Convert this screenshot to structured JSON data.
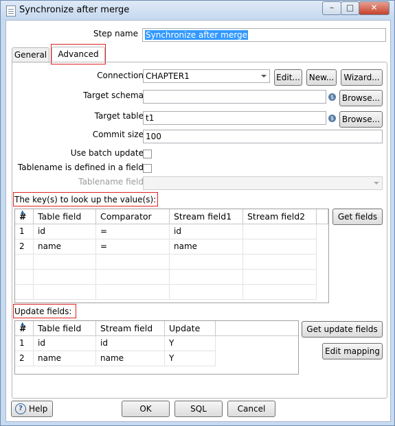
{
  "window": {
    "title": "Synchronize after merge",
    "minimize": "–",
    "maximize": "□",
    "close": "✕"
  },
  "step": {
    "label": "Step name",
    "value": "Synchronize after merge"
  },
  "tabs": [
    {
      "label": "General"
    },
    {
      "label": "Advanced"
    }
  ],
  "form": {
    "connection": {
      "label": "Connection",
      "value": "CHAPTER1",
      "edit": "Edit...",
      "new": "New...",
      "wizard": "Wizard..."
    },
    "target_schema": {
      "label": "Target schema",
      "value": "",
      "browse": "Browse..."
    },
    "target_table": {
      "label": "Target table",
      "value": "t1",
      "browse": "Browse..."
    },
    "commit_size": {
      "label": "Commit size",
      "value": "100"
    },
    "use_batch": {
      "label": "Use batch update",
      "checked": false
    },
    "tablename_in_field": {
      "label": "Tablename is defined in a field",
      "checked": false
    },
    "tablename_field": {
      "label": "Tablename field",
      "value": ""
    },
    "variable_icon": "$"
  },
  "keys": {
    "title": "The key(s) to look up the value(s):",
    "headers": [
      "#",
      "Table field",
      "Comparator",
      "Stream field1",
      "Stream field2"
    ],
    "rows": [
      [
        "1",
        "id",
        "=",
        "id",
        ""
      ],
      [
        "2",
        "name",
        "=",
        "name",
        ""
      ]
    ],
    "get_fields": "Get fields"
  },
  "update": {
    "title": "Update fields:",
    "headers": [
      "#",
      "Table field",
      "Stream field",
      "Update"
    ],
    "rows": [
      [
        "1",
        "id",
        "id",
        "Y"
      ],
      [
        "2",
        "name",
        "name",
        "Y"
      ]
    ],
    "get_update_fields": "Get update fields",
    "edit_mapping": "Edit mapping"
  },
  "footer": {
    "help": "Help",
    "help_icon": "?",
    "ok": "OK",
    "sql": "SQL",
    "cancel": "Cancel"
  }
}
